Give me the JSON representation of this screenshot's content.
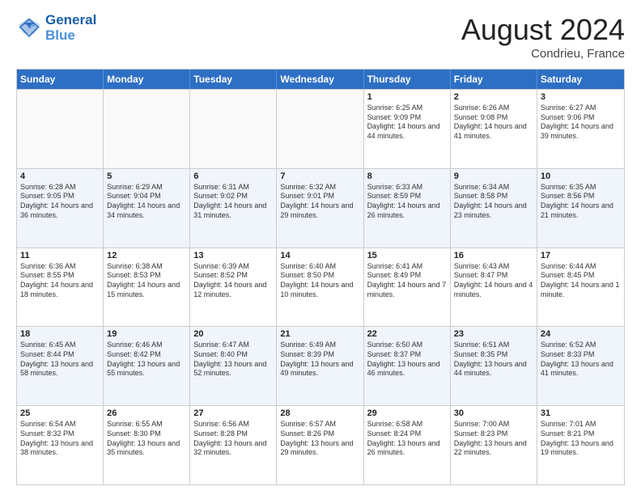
{
  "header": {
    "logo_general": "General",
    "logo_blue": "Blue",
    "month_year": "August 2024",
    "location": "Condrieu, France"
  },
  "days_of_week": [
    "Sunday",
    "Monday",
    "Tuesday",
    "Wednesday",
    "Thursday",
    "Friday",
    "Saturday"
  ],
  "rows": [
    {
      "alt": false,
      "cells": [
        {
          "day": "",
          "sunrise": "",
          "sunset": "",
          "daylight": ""
        },
        {
          "day": "",
          "sunrise": "",
          "sunset": "",
          "daylight": ""
        },
        {
          "day": "",
          "sunrise": "",
          "sunset": "",
          "daylight": ""
        },
        {
          "day": "",
          "sunrise": "",
          "sunset": "",
          "daylight": ""
        },
        {
          "day": "1",
          "sunrise": "Sunrise: 6:25 AM",
          "sunset": "Sunset: 9:09 PM",
          "daylight": "Daylight: 14 hours and 44 minutes."
        },
        {
          "day": "2",
          "sunrise": "Sunrise: 6:26 AM",
          "sunset": "Sunset: 9:08 PM",
          "daylight": "Daylight: 14 hours and 41 minutes."
        },
        {
          "day": "3",
          "sunrise": "Sunrise: 6:27 AM",
          "sunset": "Sunset: 9:06 PM",
          "daylight": "Daylight: 14 hours and 39 minutes."
        }
      ]
    },
    {
      "alt": true,
      "cells": [
        {
          "day": "4",
          "sunrise": "Sunrise: 6:28 AM",
          "sunset": "Sunset: 9:05 PM",
          "daylight": "Daylight: 14 hours and 36 minutes."
        },
        {
          "day": "5",
          "sunrise": "Sunrise: 6:29 AM",
          "sunset": "Sunset: 9:04 PM",
          "daylight": "Daylight: 14 hours and 34 minutes."
        },
        {
          "day": "6",
          "sunrise": "Sunrise: 6:31 AM",
          "sunset": "Sunset: 9:02 PM",
          "daylight": "Daylight: 14 hours and 31 minutes."
        },
        {
          "day": "7",
          "sunrise": "Sunrise: 6:32 AM",
          "sunset": "Sunset: 9:01 PM",
          "daylight": "Daylight: 14 hours and 29 minutes."
        },
        {
          "day": "8",
          "sunrise": "Sunrise: 6:33 AM",
          "sunset": "Sunset: 8:59 PM",
          "daylight": "Daylight: 14 hours and 26 minutes."
        },
        {
          "day": "9",
          "sunrise": "Sunrise: 6:34 AM",
          "sunset": "Sunset: 8:58 PM",
          "daylight": "Daylight: 14 hours and 23 minutes."
        },
        {
          "day": "10",
          "sunrise": "Sunrise: 6:35 AM",
          "sunset": "Sunset: 8:56 PM",
          "daylight": "Daylight: 14 hours and 21 minutes."
        }
      ]
    },
    {
      "alt": false,
      "cells": [
        {
          "day": "11",
          "sunrise": "Sunrise: 6:36 AM",
          "sunset": "Sunset: 8:55 PM",
          "daylight": "Daylight: 14 hours and 18 minutes."
        },
        {
          "day": "12",
          "sunrise": "Sunrise: 6:38 AM",
          "sunset": "Sunset: 8:53 PM",
          "daylight": "Daylight: 14 hours and 15 minutes."
        },
        {
          "day": "13",
          "sunrise": "Sunrise: 6:39 AM",
          "sunset": "Sunset: 8:52 PM",
          "daylight": "Daylight: 14 hours and 12 minutes."
        },
        {
          "day": "14",
          "sunrise": "Sunrise: 6:40 AM",
          "sunset": "Sunset: 8:50 PM",
          "daylight": "Daylight: 14 hours and 10 minutes."
        },
        {
          "day": "15",
          "sunrise": "Sunrise: 6:41 AM",
          "sunset": "Sunset: 8:49 PM",
          "daylight": "Daylight: 14 hours and 7 minutes."
        },
        {
          "day": "16",
          "sunrise": "Sunrise: 6:43 AM",
          "sunset": "Sunset: 8:47 PM",
          "daylight": "Daylight: 14 hours and 4 minutes."
        },
        {
          "day": "17",
          "sunrise": "Sunrise: 6:44 AM",
          "sunset": "Sunset: 8:45 PM",
          "daylight": "Daylight: 14 hours and 1 minute."
        }
      ]
    },
    {
      "alt": true,
      "cells": [
        {
          "day": "18",
          "sunrise": "Sunrise: 6:45 AM",
          "sunset": "Sunset: 8:44 PM",
          "daylight": "Daylight: 13 hours and 58 minutes."
        },
        {
          "day": "19",
          "sunrise": "Sunrise: 6:46 AM",
          "sunset": "Sunset: 8:42 PM",
          "daylight": "Daylight: 13 hours and 55 minutes."
        },
        {
          "day": "20",
          "sunrise": "Sunrise: 6:47 AM",
          "sunset": "Sunset: 8:40 PM",
          "daylight": "Daylight: 13 hours and 52 minutes."
        },
        {
          "day": "21",
          "sunrise": "Sunrise: 6:49 AM",
          "sunset": "Sunset: 8:39 PM",
          "daylight": "Daylight: 13 hours and 49 minutes."
        },
        {
          "day": "22",
          "sunrise": "Sunrise: 6:50 AM",
          "sunset": "Sunset: 8:37 PM",
          "daylight": "Daylight: 13 hours and 46 minutes."
        },
        {
          "day": "23",
          "sunrise": "Sunrise: 6:51 AM",
          "sunset": "Sunset: 8:35 PM",
          "daylight": "Daylight: 13 hours and 44 minutes."
        },
        {
          "day": "24",
          "sunrise": "Sunrise: 6:52 AM",
          "sunset": "Sunset: 8:33 PM",
          "daylight": "Daylight: 13 hours and 41 minutes."
        }
      ]
    },
    {
      "alt": false,
      "cells": [
        {
          "day": "25",
          "sunrise": "Sunrise: 6:54 AM",
          "sunset": "Sunset: 8:32 PM",
          "daylight": "Daylight: 13 hours and 38 minutes."
        },
        {
          "day": "26",
          "sunrise": "Sunrise: 6:55 AM",
          "sunset": "Sunset: 8:30 PM",
          "daylight": "Daylight: 13 hours and 35 minutes."
        },
        {
          "day": "27",
          "sunrise": "Sunrise: 6:56 AM",
          "sunset": "Sunset: 8:28 PM",
          "daylight": "Daylight: 13 hours and 32 minutes."
        },
        {
          "day": "28",
          "sunrise": "Sunrise: 6:57 AM",
          "sunset": "Sunset: 8:26 PM",
          "daylight": "Daylight: 13 hours and 29 minutes."
        },
        {
          "day": "29",
          "sunrise": "Sunrise: 6:58 AM",
          "sunset": "Sunset: 8:24 PM",
          "daylight": "Daylight: 13 hours and 26 minutes."
        },
        {
          "day": "30",
          "sunrise": "Sunrise: 7:00 AM",
          "sunset": "Sunset: 8:23 PM",
          "daylight": "Daylight: 13 hours and 22 minutes."
        },
        {
          "day": "31",
          "sunrise": "Sunrise: 7:01 AM",
          "sunset": "Sunset: 8:21 PM",
          "daylight": "Daylight: 13 hours and 19 minutes."
        }
      ]
    }
  ]
}
